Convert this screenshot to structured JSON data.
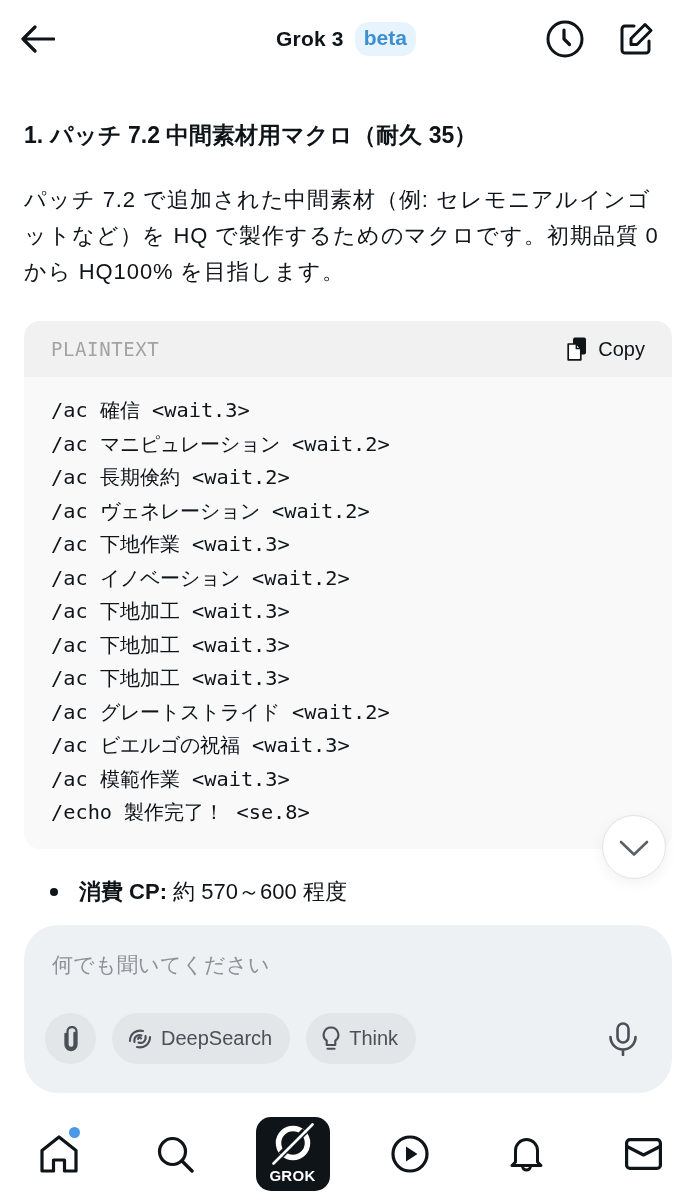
{
  "header": {
    "title": "Grok 3",
    "badge": "beta"
  },
  "message": {
    "heading": "1. パッチ 7.2 中間素材用マクロ（耐久 35）",
    "paragraph": "パッチ 7.2 で追加された中間素材（例: セレモニアルインゴットなど）を HQ で製作するためのマクロです。初期品質 0 から HQ100% を目指します。",
    "code_block": {
      "language": "PLAINTEXT",
      "copy_label": "Copy",
      "lines": [
        "/ac 確信 <wait.3>",
        "/ac マニピュレーション <wait.2>",
        "/ac 長期倹約 <wait.2>",
        "/ac ヴェネレーション <wait.2>",
        "/ac 下地作業 <wait.3>",
        "/ac イノベーション <wait.2>",
        "/ac 下地加工 <wait.3>",
        "/ac 下地加工 <wait.3>",
        "/ac 下地加工 <wait.3>",
        "/ac グレートストライド <wait.2>",
        "/ac ビエルゴの祝福 <wait.3>",
        "/ac 模範作業 <wait.3>",
        "/echo 製作完了！ <se.8>"
      ]
    },
    "bullets": [
      "**消費 CP:** 約 570～600 程度"
    ]
  },
  "composer": {
    "placeholder": "何でも聞いてください",
    "tools": [
      {
        "kind": "attach",
        "selected": false
      },
      {
        "kind": "deepsearch",
        "label": "DeepSearch",
        "selected": false
      },
      {
        "kind": "think",
        "label": "Think",
        "selected": false
      }
    ]
  },
  "nav": [
    {
      "kind": "home",
      "badge": true
    },
    {
      "kind": "search",
      "badge": false
    },
    {
      "kind": "grok",
      "label": "GROK",
      "badge": false
    },
    {
      "kind": "video",
      "badge": false
    },
    {
      "kind": "notifications",
      "badge": false
    },
    {
      "kind": "messages",
      "badge": false
    }
  ]
}
